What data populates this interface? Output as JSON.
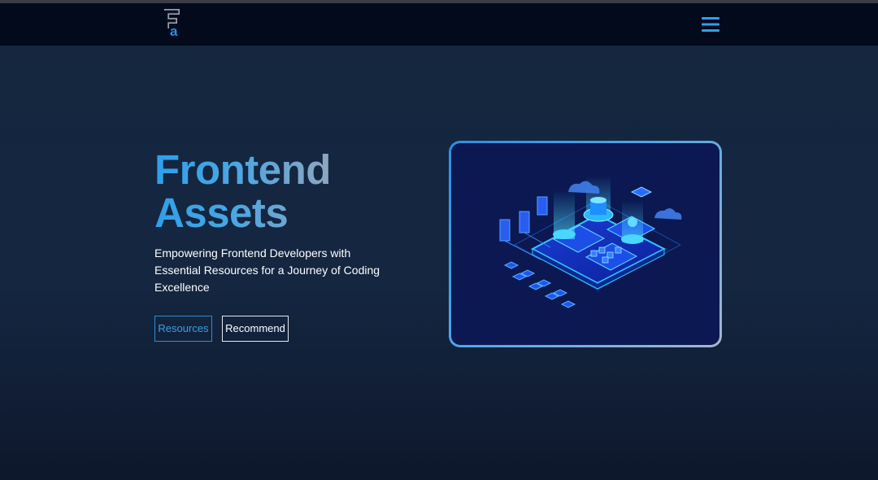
{
  "navbar": {
    "logo_text": "Fa",
    "logo_icon": "fa-monogram-logo",
    "menu_icon": "hamburger-menu-icon"
  },
  "hero": {
    "title_line1": "Frontend",
    "title_line2": "Assets",
    "description": "Empowering Frontend Developers with Essential Resources for a Journey of Coding Excellence",
    "buttons": {
      "resources": "Resources",
      "recommend": "Recommend"
    },
    "illustration": "isometric-data-center-illustration"
  },
  "colors": {
    "accent": "#2ea0ea",
    "navbar_bg": "#020a1c",
    "hero_bg": "#14273f",
    "illustration_bg": "#0b1852"
  }
}
